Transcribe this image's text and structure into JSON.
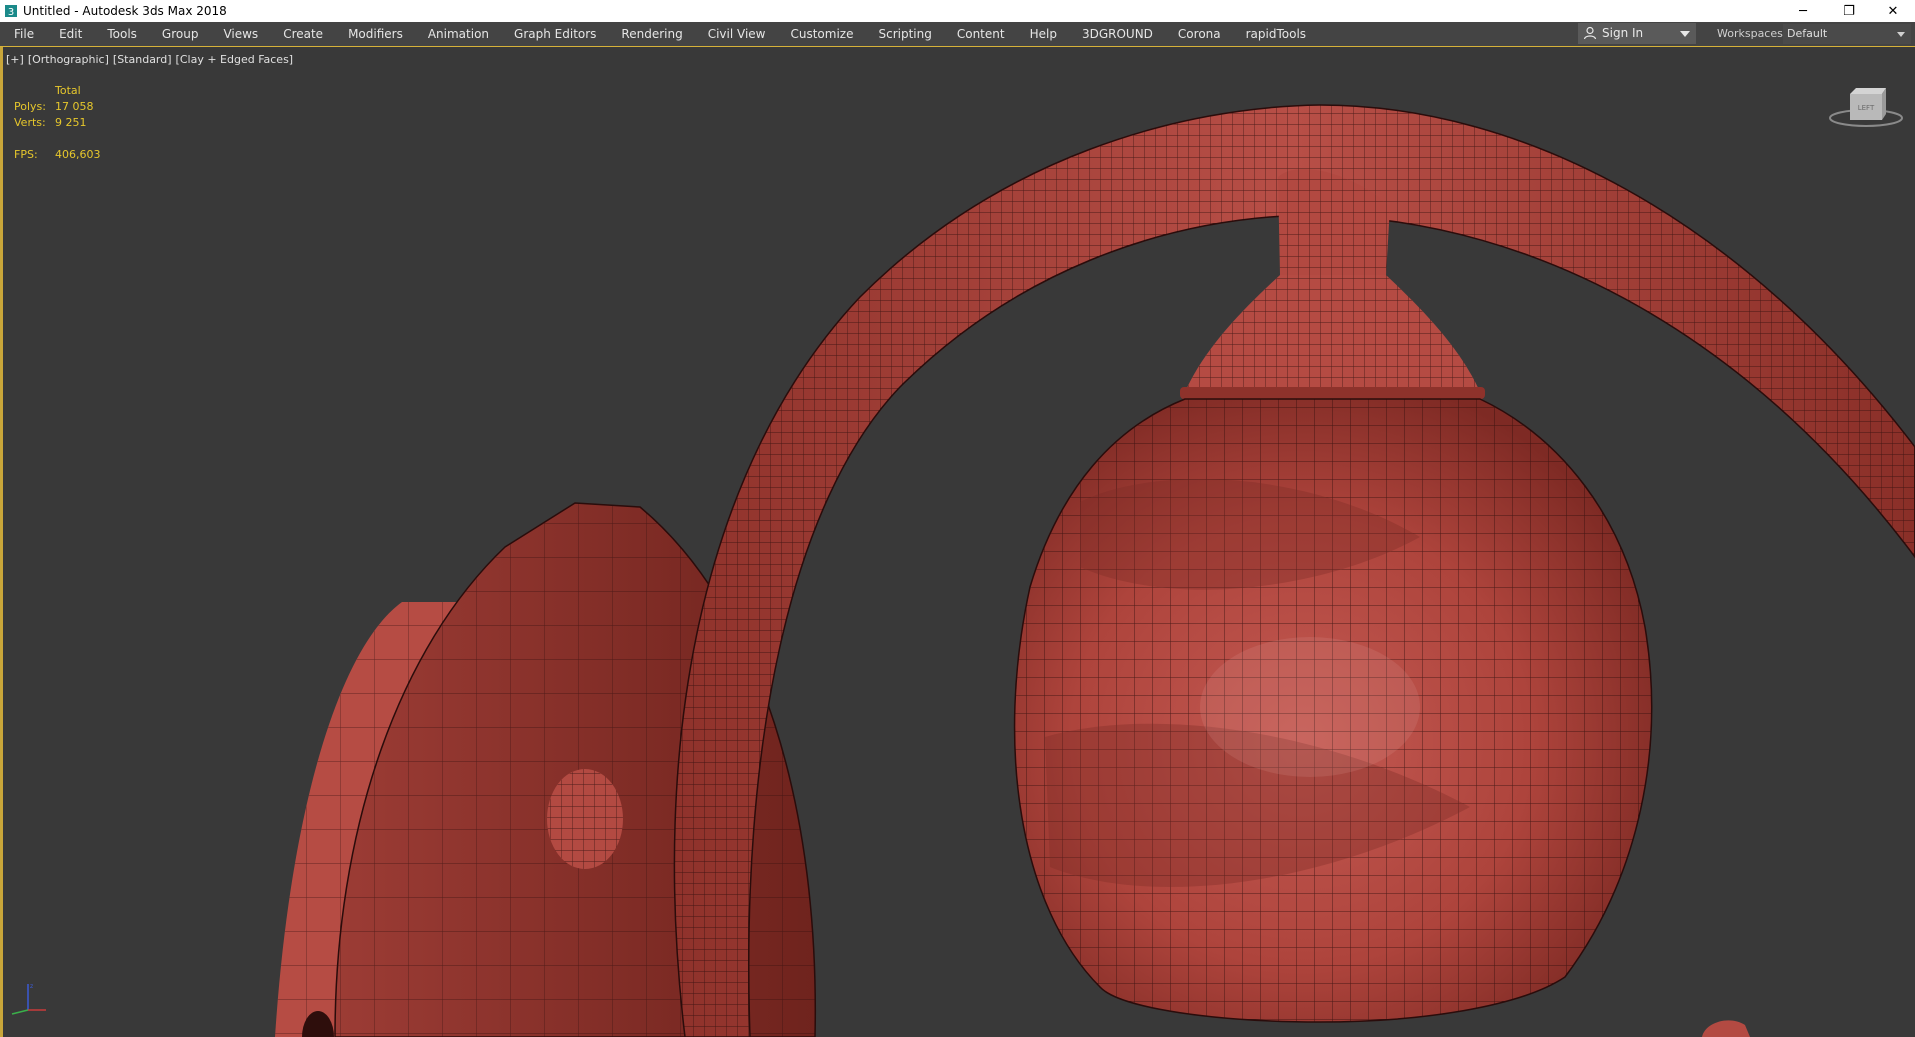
{
  "window": {
    "title": "Untitled - Autodesk 3ds Max 2018",
    "controls": [
      "minimize-icon",
      "restore-icon",
      "close-icon"
    ],
    "minimize_glyph": "─",
    "restore_glyph": "❐",
    "close_glyph": "✕"
  },
  "menu": {
    "items": [
      "File",
      "Edit",
      "Tools",
      "Group",
      "Views",
      "Create",
      "Modifiers",
      "Animation",
      "Graph Editors",
      "Rendering",
      "Civil View",
      "Customize",
      "Scripting",
      "Content",
      "Help",
      "3DGROUND",
      "Corona",
      "rapidTools"
    ],
    "sign_in": "Sign In",
    "workspaces_label": "Workspaces:",
    "workspaces_value": "Default"
  },
  "viewport": {
    "labels": [
      "[+]",
      "[Orthographic]",
      "[Standard]",
      "[Clay + Edged Faces]"
    ],
    "stats": {
      "total_label": "Total",
      "polys_label": "Polys:",
      "polys_value": "17 058",
      "verts_label": "Verts:",
      "verts_value": "9 251",
      "fps_label": "FPS:",
      "fps_value": "406,603"
    },
    "viewcube_label": "LEFT"
  },
  "colors": {
    "accent": "#d6b23a",
    "stats_text": "#e6c72c",
    "model_red": "#b0463f",
    "viewport_bg": "#393939"
  }
}
